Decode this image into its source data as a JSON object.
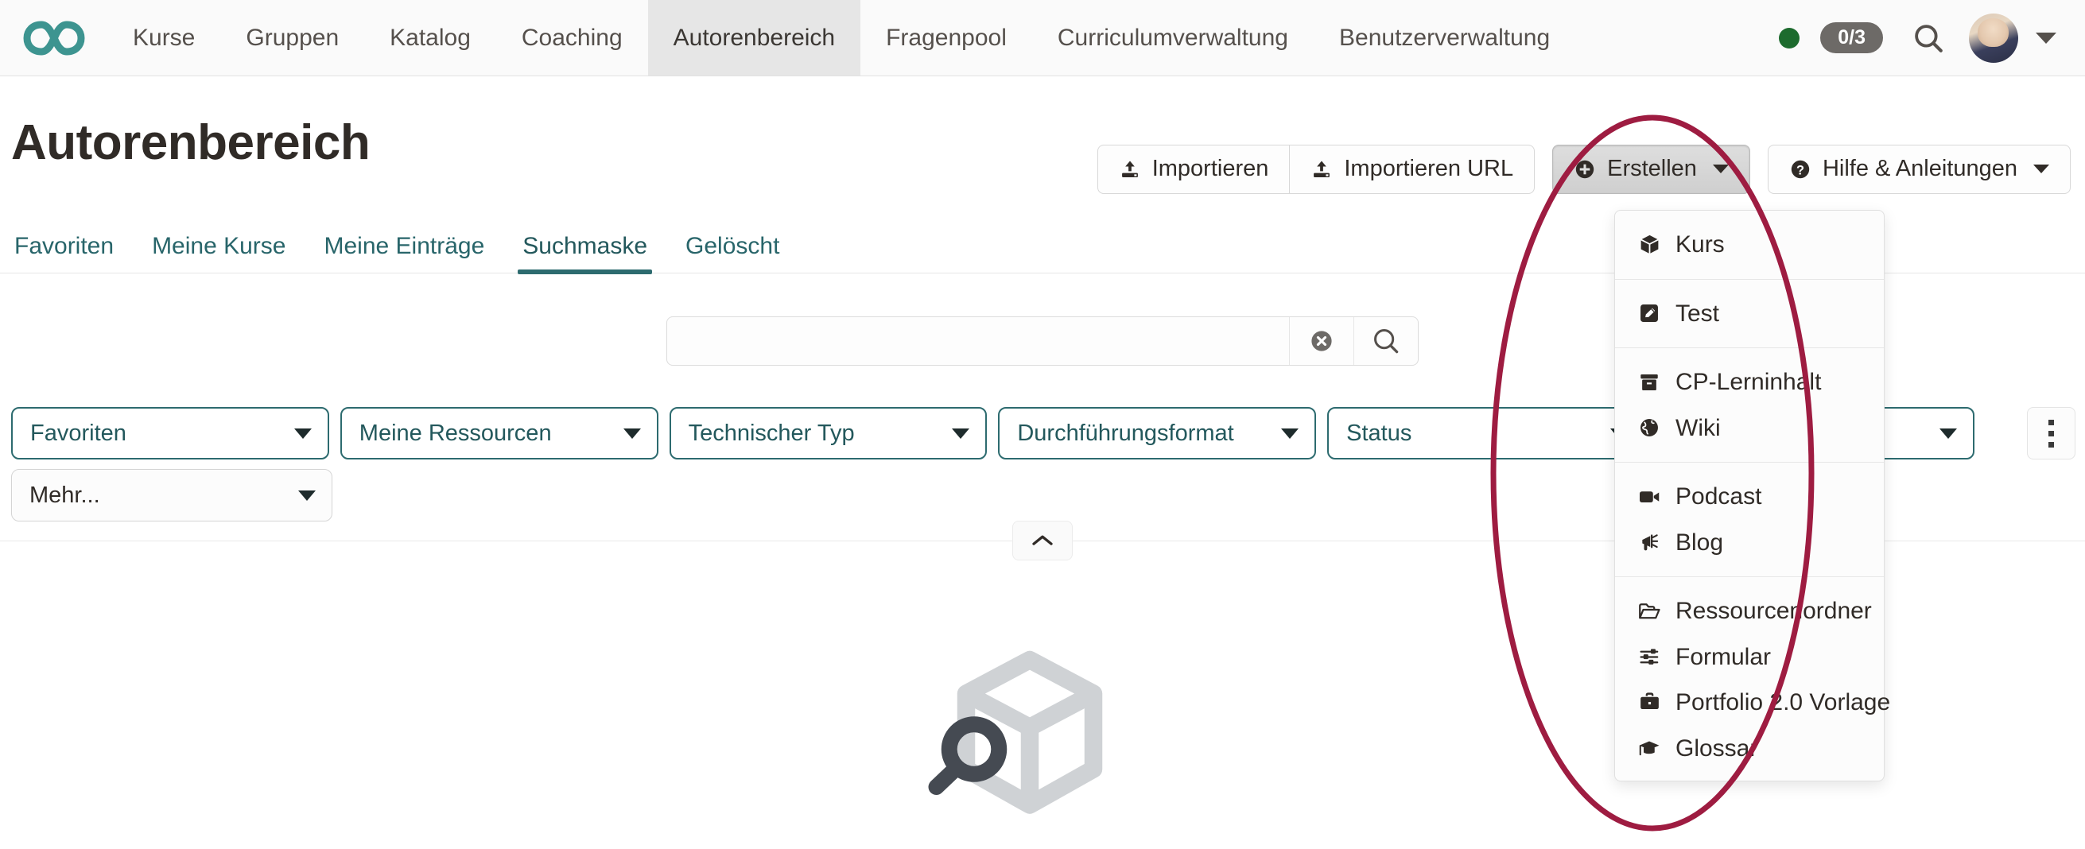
{
  "header": {
    "logo_icon": "infinity-logo-icon",
    "brand_color": "#3d9490",
    "nav_items": [
      {
        "label": "Kurse",
        "active": false
      },
      {
        "label": "Gruppen",
        "active": false
      },
      {
        "label": "Katalog",
        "active": false
      },
      {
        "label": "Coaching",
        "active": false
      },
      {
        "label": "Autorenbereich",
        "active": true
      },
      {
        "label": "Fragenpool",
        "active": false
      },
      {
        "label": "Curriculumverwaltung",
        "active": false
      },
      {
        "label": "Benutzerverwaltung",
        "active": false
      }
    ],
    "status_dot_color": "#1d6b2e",
    "task_count": "0/3",
    "search_icon": "search-icon",
    "avatar_icon": "user-avatar",
    "user_caret_icon": "chevron-down-icon"
  },
  "page": {
    "title": "Autorenbereich"
  },
  "toolbar": {
    "import_label": "Importieren",
    "import_url_label": "Importieren URL",
    "create_label": "Erstellen",
    "help_label": "Hilfe & Anleitungen",
    "import_icon": "upload-icon",
    "create_icon": "plus-circle-icon",
    "help_icon": "question-circle-icon",
    "create_active": true
  },
  "tabs": [
    {
      "label": "Favoriten",
      "active": false
    },
    {
      "label": "Meine Kurse",
      "active": false
    },
    {
      "label": "Meine Einträge",
      "active": false
    },
    {
      "label": "Suchmaske",
      "active": true
    },
    {
      "label": "Gelöscht",
      "active": false
    }
  ],
  "search": {
    "value": "",
    "placeholder": "",
    "clear_icon": "clear-circle-icon",
    "submit_icon": "search-icon"
  },
  "filters": {
    "row1": [
      {
        "label": "Favoriten"
      },
      {
        "label": "Meine Ressourcen"
      },
      {
        "label": "Technischer Typ"
      },
      {
        "label": "Durchführungsformat"
      },
      {
        "label": "Status"
      },
      {
        "label": ""
      }
    ],
    "more_label": "Mehr...",
    "kebab_icon": "more-vertical-icon"
  },
  "collapse": {
    "icon": "chevron-up-icon"
  },
  "empty_state": {
    "cube_icon": "cube-search-icon",
    "cube_color": "#cfd2d5",
    "glass_color": "#454a52"
  },
  "create_menu": {
    "groups": [
      {
        "items": [
          {
            "label": "Kurs",
            "icon": "cube-icon"
          }
        ]
      },
      {
        "items": [
          {
            "label": "Test",
            "icon": "pencil-square-icon"
          }
        ]
      },
      {
        "items": [
          {
            "label": "CP-Lerninhalt",
            "icon": "archive-box-icon"
          },
          {
            "label": "Wiki",
            "icon": "globe-icon"
          }
        ]
      },
      {
        "items": [
          {
            "label": "Podcast",
            "icon": "video-camera-icon"
          },
          {
            "label": "Blog",
            "icon": "bullhorn-icon"
          }
        ]
      },
      {
        "items": [
          {
            "label": "Ressourcenordner",
            "icon": "folder-open-icon"
          },
          {
            "label": "Formular",
            "icon": "sliders-icon"
          },
          {
            "label": "Portfolio 2.0 Vorlage",
            "icon": "briefcase-icon"
          },
          {
            "label": "Glossar",
            "icon": "graduation-cap-icon"
          }
        ]
      }
    ]
  },
  "annotation": {
    "shape": "ellipse-highlight",
    "color": "#9e1c41"
  }
}
